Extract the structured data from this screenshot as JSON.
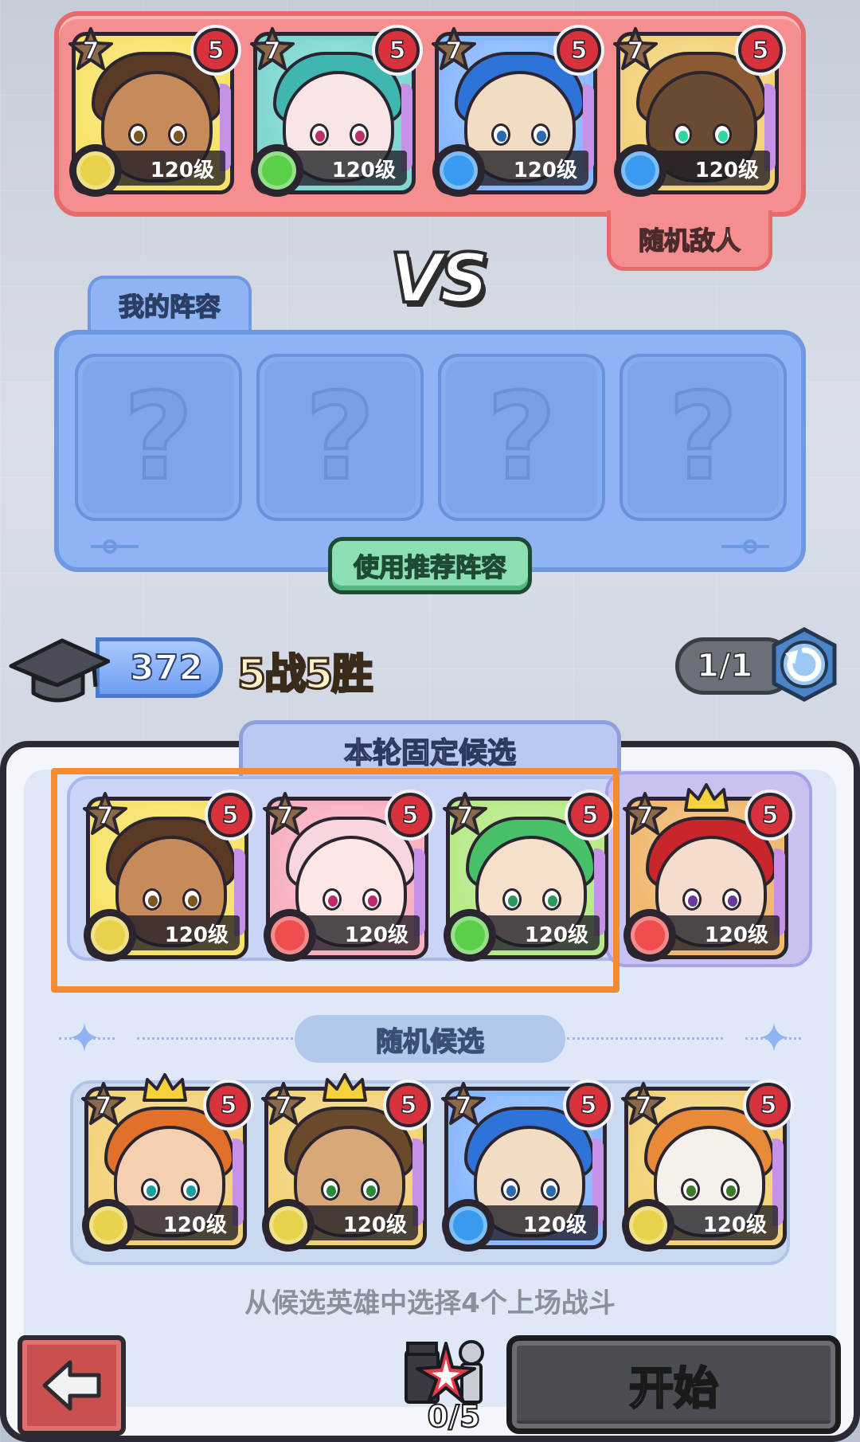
{
  "enemy": {
    "header_partial": "",
    "random_enemy_label": "随机敌人",
    "heroes": [
      {
        "stars": "7",
        "rank": "5",
        "level": "120级",
        "element": "earth",
        "bg": "#f8e36a",
        "hair": "#5a3a24",
        "skin": "#c98a5a",
        "eye": "#7a5620"
      },
      {
        "stars": "7",
        "rank": "5",
        "level": "120级",
        "element": "wind",
        "bg": "#7fd7d0",
        "hair": "#3fb7b0",
        "skin": "#f8e6e6",
        "eye": "#c0306a"
      },
      {
        "stars": "7",
        "rank": "5",
        "level": "120级",
        "element": "water",
        "bg": "#8ab8ff",
        "hair": "#2f72d8",
        "skin": "#f3dcc4",
        "eye": "#2a6ab0"
      },
      {
        "stars": "7",
        "rank": "5",
        "level": "120级",
        "element": "water",
        "bg": "#f3d27a",
        "hair": "#8a5a32",
        "skin": "#6a4a30",
        "eye": "#2ad8a0"
      }
    ]
  },
  "vs_label": "VS",
  "my_lineup": {
    "tab_label": "我的阵容",
    "slot_placeholder": "?",
    "recommend_button": "使用推荐阵容"
  },
  "score": {
    "value": "372",
    "record": "5战5胜",
    "refresh_count": "1/1"
  },
  "candidates": {
    "fixed_tab": "本轮固定候选",
    "fixed_heroes": [
      {
        "stars": "7",
        "rank": "5",
        "level": "120级",
        "element": "earth",
        "bg": "#f8e36a",
        "hair": "#5a3a24",
        "skin": "#c98a5a",
        "eye": "#7a5620",
        "crown": false
      },
      {
        "stars": "7",
        "rank": "5",
        "level": "120级",
        "element": "fire",
        "bg": "#f8b0c0",
        "hair": "#f7d6de",
        "skin": "#fde6e4",
        "eye": "#c02a6a",
        "crown": false
      },
      {
        "stars": "7",
        "rank": "5",
        "level": "120级",
        "element": "wind",
        "bg": "#b6ea88",
        "hair": "#48c068",
        "skin": "#f6e0cc",
        "eye": "#2a9a5a",
        "crown": false
      },
      {
        "stars": "7",
        "rank": "5",
        "level": "120级",
        "element": "fire",
        "bg": "#f0b870",
        "hair": "#c8262a",
        "skin": "#f6dccc",
        "eye": "#6a3a9a",
        "crown": true
      }
    ],
    "random_tab": "随机候选",
    "random_heroes": [
      {
        "stars": "7",
        "rank": "5",
        "level": "120级",
        "element": "earth",
        "bg": "#f3d27a",
        "hair": "#e0702a",
        "skin": "#f4d0b0",
        "eye": "#1aa0a0",
        "crown": true
      },
      {
        "stars": "7",
        "rank": "5",
        "level": "120级",
        "element": "earth",
        "bg": "#f3d27a",
        "hair": "#6a4a2a",
        "skin": "#d8a878",
        "eye": "#2a8a3a",
        "crown": true
      },
      {
        "stars": "7",
        "rank": "5",
        "level": "120级",
        "element": "water",
        "bg": "#8ab8ff",
        "hair": "#2f72d8",
        "skin": "#f3dcc4",
        "eye": "#2a6ab0",
        "crown": false
      },
      {
        "stars": "7",
        "rank": "5",
        "level": "120级",
        "element": "earth",
        "bg": "#f3d27a",
        "hair": "#e88a3a",
        "skin": "#f6f0ea",
        "eye": "#3a7a2a",
        "crown": false
      }
    ],
    "hint": "从候选英雄中选择4个上场战斗"
  },
  "bottom": {
    "selected_count": "0/5",
    "start_button": "开始"
  },
  "colors": {
    "enemy_panel": "#f58f8f",
    "my_panel": "#8fb4f4",
    "highlight": "#f58a30",
    "element_earth": "#e8d24a",
    "element_wind": "#5ccf4a",
    "element_water": "#3a9af0",
    "element_fire": "#ef4d4d"
  }
}
